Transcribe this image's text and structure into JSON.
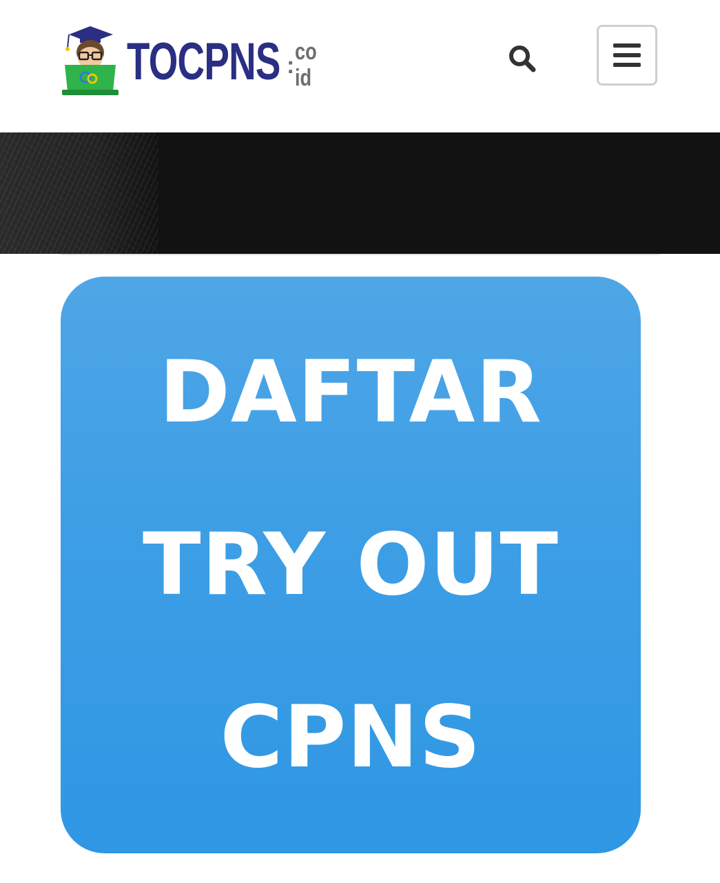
{
  "header": {
    "logo": {
      "main_text": "TOCPNS",
      "tld_colon": ":",
      "tld_top": "co",
      "tld_bottom": "id",
      "main_color": "#2a2f83",
      "tld_color": "#6d6e71"
    },
    "search_icon": "search-icon",
    "menu_icon": "hamburger-menu-icon"
  },
  "banner": {
    "color": "#121212"
  },
  "cta": {
    "lines": [
      "DAFTAR",
      "TRY OUT",
      "CPNS"
    ],
    "background": "#3d9ee5",
    "text_color": "#ffffff"
  }
}
